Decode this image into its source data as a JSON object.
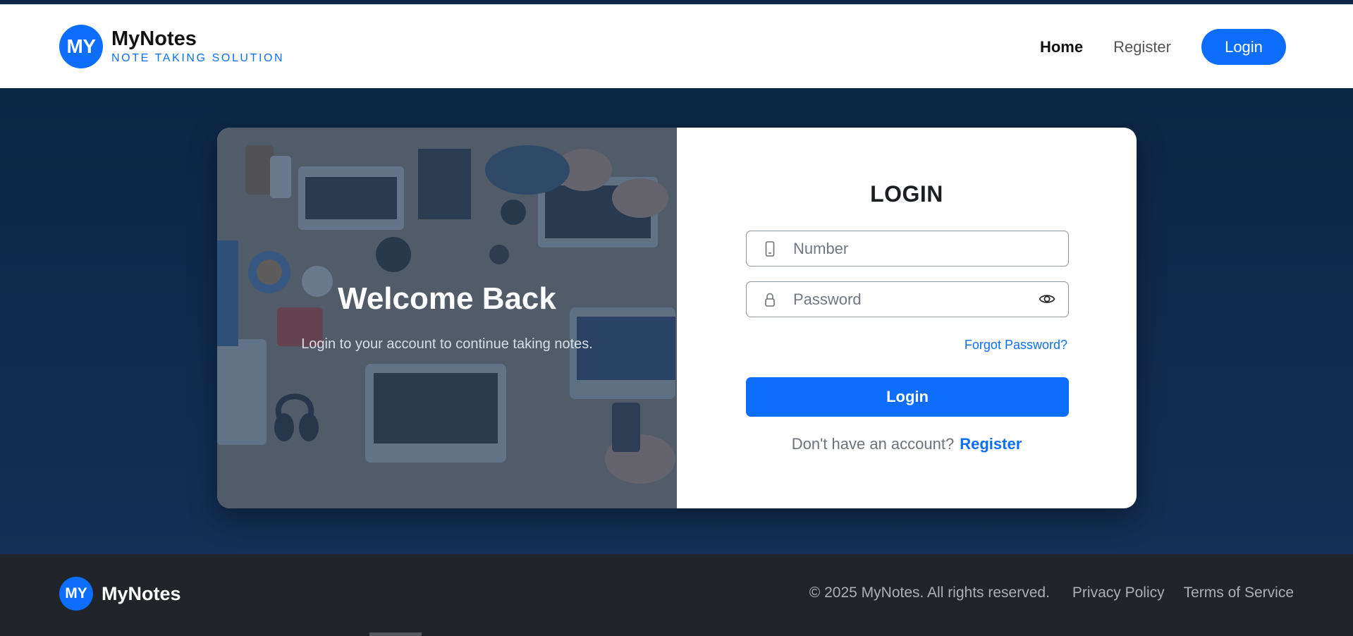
{
  "header": {
    "logo_text": "MY",
    "brand_name": "MyNotes",
    "tagline": "NOTE TAKING SOLUTION",
    "nav": {
      "home": "Home",
      "register": "Register",
      "login": "Login"
    }
  },
  "hero": {
    "title": "Welcome Back",
    "subtitle": "Login to your account to continue taking notes."
  },
  "login_form": {
    "title": "LOGIN",
    "number_placeholder": "Number",
    "password_placeholder": "Password",
    "forgot_label": "Forgot Password?",
    "submit_label": "Login",
    "no_account_text": "Don't have an account?",
    "register_link": "Register"
  },
  "footer": {
    "logo_text": "MY",
    "brand_name": "MyNotes",
    "copyright": "© 2025 MyNotes. All rights reserved.",
    "privacy": "Privacy Policy",
    "terms": "Terms of Service"
  },
  "icons": {
    "number_field": "phone-icon",
    "password_field": "lock-icon",
    "password_toggle": "eye-icon"
  },
  "colors": {
    "accent": "#0d6efd",
    "background": "#0e2748",
    "footer": "#212429"
  }
}
